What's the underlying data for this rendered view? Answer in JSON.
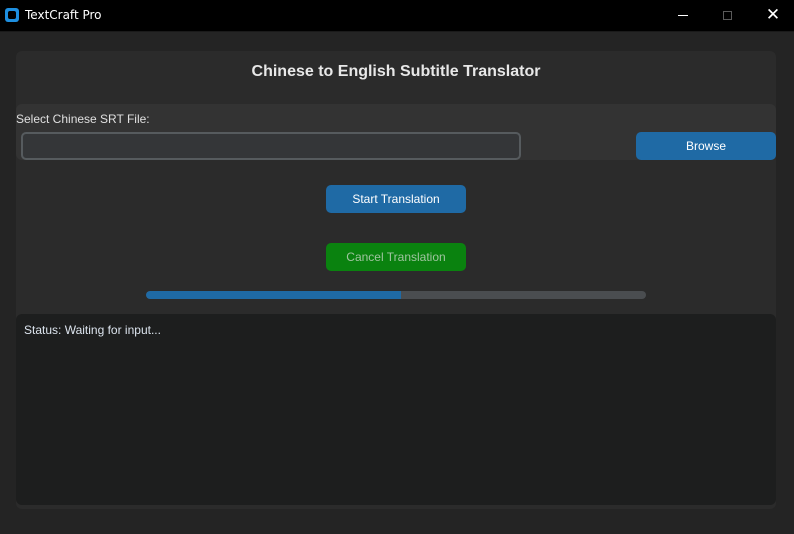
{
  "window": {
    "title": "TextCraft Pro",
    "controls": {
      "minimize": "minimize-icon",
      "maximize": "maximize-icon",
      "close_glyph": "✕"
    }
  },
  "header": {
    "title": "Chinese to English Subtitle Translator"
  },
  "file_select": {
    "label": "Select Chinese SRT File:",
    "value": "",
    "placeholder": "",
    "browse_label": "Browse"
  },
  "actions": {
    "start_label": "Start Translation",
    "cancel_label": "Cancel Translation"
  },
  "progress": {
    "fraction": 0.51
  },
  "status": {
    "text": "Status: Waiting for input..."
  },
  "colors": {
    "accent": "#1f6aa5",
    "cancel_green": "#0a820f",
    "background": "#242424"
  }
}
